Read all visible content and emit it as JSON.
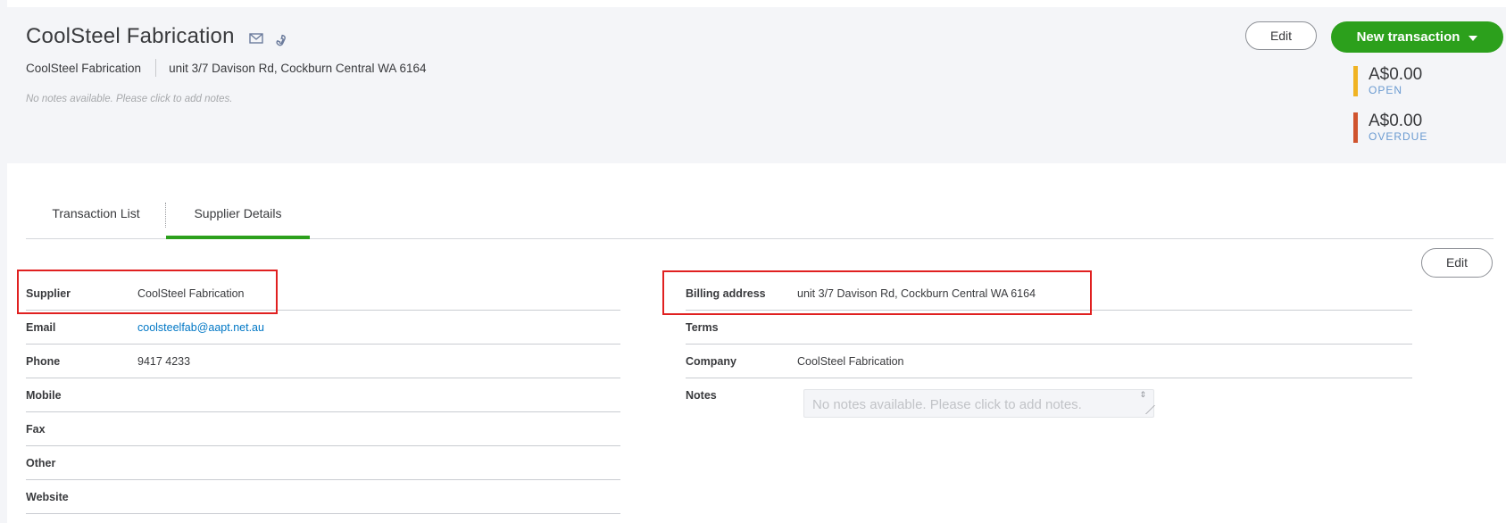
{
  "header": {
    "title": "CoolSteel Fabrication",
    "company_name": "CoolSteel Fabrication",
    "address": "unit 3/7 Davison Rd, Cockburn Central WA 6164",
    "notes_hint": "No notes available. Please click to add notes.",
    "edit_label": "Edit",
    "new_transaction_label": "New transaction",
    "open_amount": "A$0.00",
    "open_label": "OPEN",
    "overdue_amount": "A$0.00",
    "overdue_label": "OVERDUE",
    "icons": [
      "mail-icon",
      "phone-icon"
    ]
  },
  "tabs": [
    {
      "label": "Transaction List",
      "active": false
    },
    {
      "label": "Supplier Details",
      "active": true
    }
  ],
  "details_edit_label": "Edit",
  "left_details": [
    {
      "key": "Supplier",
      "value": "CoolSteel Fabrication"
    },
    {
      "key": "Email",
      "value": "coolsteelfab@aapt.net.au"
    },
    {
      "key": "Phone",
      "value": "9417 4233"
    },
    {
      "key": "Mobile",
      "value": ""
    },
    {
      "key": "Fax",
      "value": ""
    },
    {
      "key": "Other",
      "value": ""
    },
    {
      "key": "Website",
      "value": ""
    }
  ],
  "right_details": [
    {
      "key": "Billing address",
      "value": "unit 3/7 Davison Rd, Cockburn Central WA 6164"
    },
    {
      "key": "Terms",
      "value": ""
    },
    {
      "key": "Company",
      "value": "CoolSteel Fabrication"
    },
    {
      "key": "Notes",
      "value": ""
    }
  ],
  "notes_placeholder": "No notes available. Please click to add notes.",
  "colors": {
    "accent_green": "#2ca01c",
    "open_bar": "#f0b323",
    "overdue_bar": "#d0532e",
    "link": "#0077c5",
    "highlight": "#e02020"
  }
}
